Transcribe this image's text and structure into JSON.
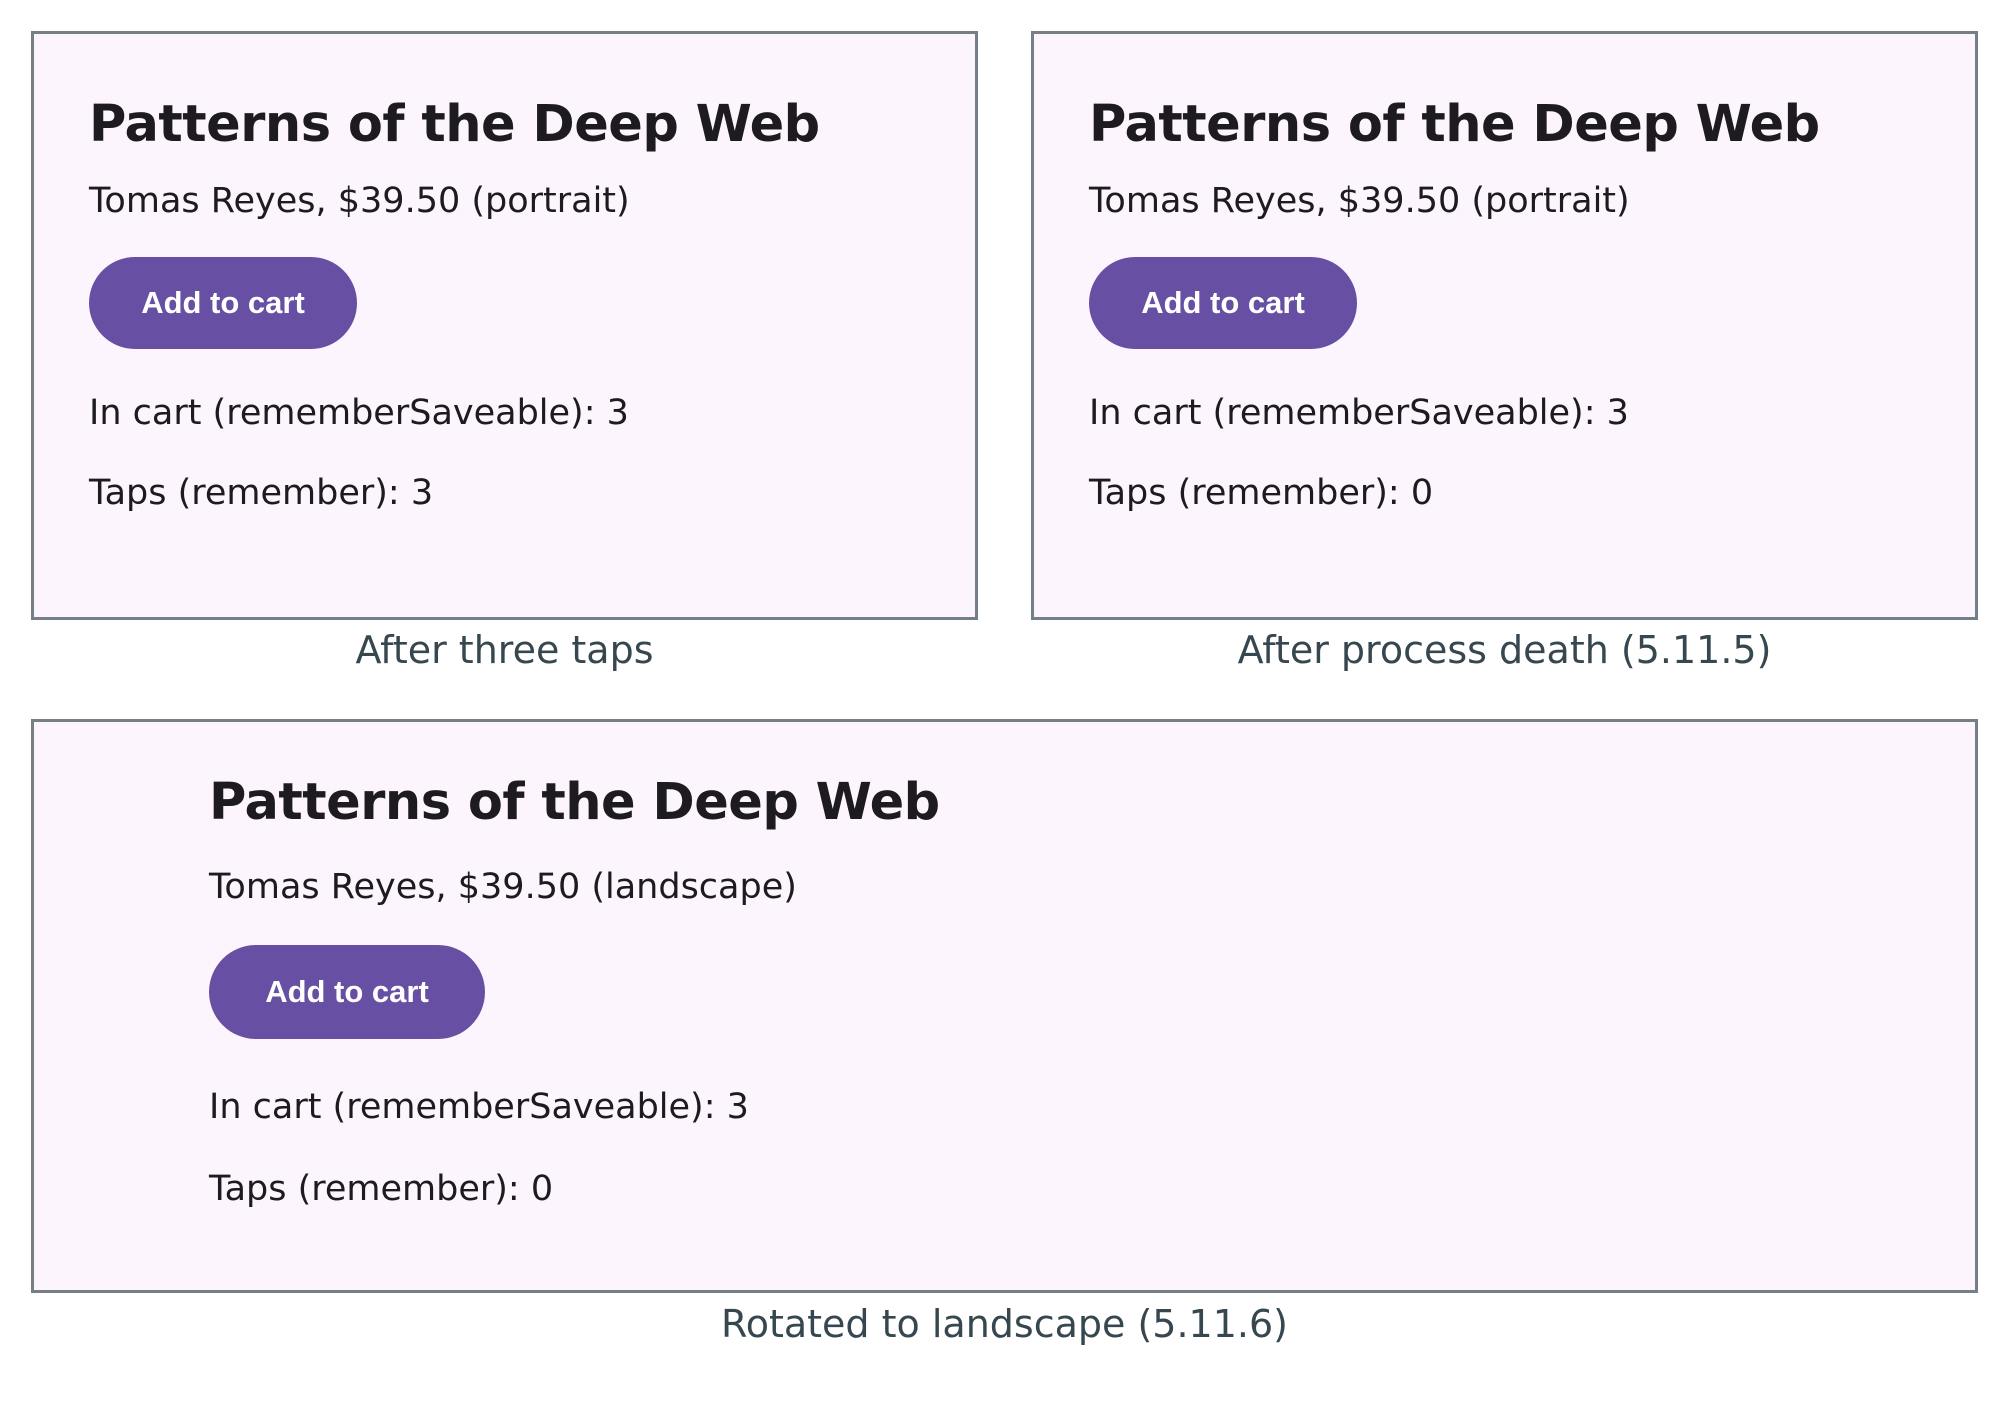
{
  "panels": [
    {
      "title": "Patterns of the Deep Web",
      "subtitle": "Tomas Reyes, $39.50 (portrait)",
      "button_label": "Add to cart",
      "cart_line": "In cart (rememberSaveable): 3",
      "taps_line": "Taps (remember): 3",
      "caption": "After three taps"
    },
    {
      "title": "Patterns of the Deep Web",
      "subtitle": "Tomas Reyes, $39.50 (portrait)",
      "button_label": "Add to cart",
      "cart_line": "In cart (rememberSaveable): 3",
      "taps_line": "Taps (remember): 0",
      "caption": "After process death (5.11.5)"
    },
    {
      "title": "Patterns of the Deep Web",
      "subtitle": "Tomas Reyes, $39.50 (landscape)",
      "button_label": "Add to cart",
      "cart_line": "In cart (rememberSaveable): 3",
      "taps_line": "Taps (remember): 0",
      "caption": "Rotated to landscape (5.11.6)"
    }
  ],
  "colors": {
    "panel_background": "#fcf5fd",
    "panel_border": "#757f88",
    "button": "#6750a4",
    "button_text": "#ffffff",
    "text": "#1d1b20",
    "caption": "#37474f"
  }
}
